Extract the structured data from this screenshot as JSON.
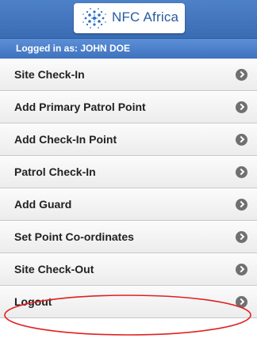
{
  "header": {
    "logo_text": "NFC Africa",
    "logged_in_text": "Logged in as: JOHN DOE"
  },
  "menu": {
    "items": [
      {
        "label": "Site Check-In"
      },
      {
        "label": "Add Primary Patrol Point"
      },
      {
        "label": "Add Check-In Point"
      },
      {
        "label": "Patrol Check-In"
      },
      {
        "label": "Add Guard"
      },
      {
        "label": "Set Point Co-ordinates"
      },
      {
        "label": "Site Check-Out"
      },
      {
        "label": "Logout"
      }
    ]
  },
  "annotation": {
    "highlight_color": "#e02020",
    "highlighted_item": "Logout"
  },
  "colors": {
    "header_blue": "#3a6cb4",
    "chevron_gray": "#707070"
  }
}
